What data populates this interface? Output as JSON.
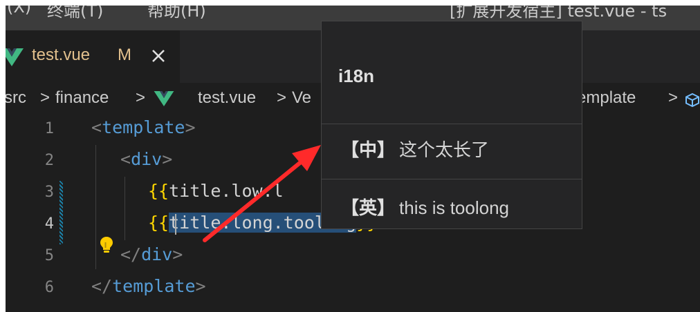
{
  "menubar": {
    "items": [
      "(X)",
      "终端(T)",
      "帮助(H)"
    ],
    "window_title": "[扩展开发宿主] test.vue - ts"
  },
  "tab": {
    "label": "test.vue",
    "status": "M",
    "close": "✕"
  },
  "breadcrumb": {
    "src": "src",
    "separator": ">",
    "finance": "finance",
    "file": "test.vue",
    "partial": "Ve",
    "template": "emplate"
  },
  "editor": {
    "line_numbers": [
      "1",
      "2",
      "3",
      "4",
      "5",
      "6"
    ],
    "lines": {
      "l1_tag": "template",
      "l2_tag": "div",
      "l3_open": "{{",
      "l3_expr": "title.low.l",
      "l4_open": "{{",
      "l4_expr": "title.long.toolong",
      "l4_close": "}}",
      "l5_tag": "div",
      "l6_tag": "template"
    }
  },
  "hover": {
    "title": "i18n",
    "rows": [
      {
        "tag": "【中】",
        "text": "这个太长了"
      },
      {
        "tag": "【英】",
        "text": "this is toolong"
      }
    ]
  },
  "colors": {
    "editor_bg": "#1e1e1e",
    "keyword": "#569cd6",
    "brace": "#ffd700",
    "selection": "#264f78",
    "modified": "#e2c08d",
    "vue_green": "#41b883",
    "arrow": "#ff2a2a"
  },
  "icons": [
    "vue-icon",
    "close-icon",
    "chevron-right-icon",
    "lightbulb-icon",
    "cube-icon"
  ]
}
